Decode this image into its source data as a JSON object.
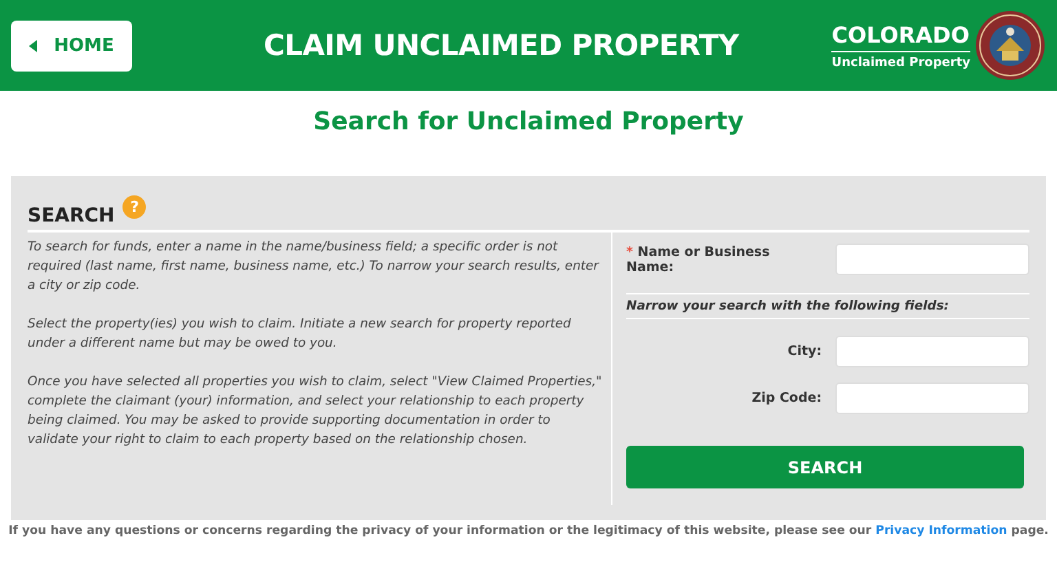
{
  "header": {
    "home_button": "HOME",
    "title": "CLAIM UNCLAIMED PROPERTY",
    "brand": {
      "name": "COLORADO",
      "subtitle": "Unclaimed Property"
    }
  },
  "page_title": "Search for Unclaimed Property",
  "search_panel": {
    "heading": "SEARCH",
    "help": "?",
    "instructions": [
      "To search for funds, enter a name in the name/business field; a specific order is not required (last name, first name, business name, etc.) To narrow your search results, enter a city or zip code.",
      "Select the property(ies) you wish to claim. Initiate a new search for property reported under a different name but may be owed to you.",
      "Once you have selected all properties you wish to claim, select \"View Claimed Properties,\" complete the claimant (your) information, and select your relationship to each property being claimed. You may be asked to provide supporting documentation in order to validate your right to claim to each property based on the relationship chosen."
    ],
    "required_fields": [
      {
        "marker": "*",
        "label": "Name or Business Name:"
      }
    ],
    "narrow_heading": "Narrow your search with the following fields:",
    "optional_fields": [
      {
        "label": "City:"
      },
      {
        "label": "Zip Code:"
      }
    ],
    "search_button": "SEARCH"
  },
  "footer": {
    "text": "If you have any questions or concerns regarding the privacy of your information or the legitimacy of this website, please see our",
    "link": "Privacy Information",
    "text_after": "page."
  }
}
